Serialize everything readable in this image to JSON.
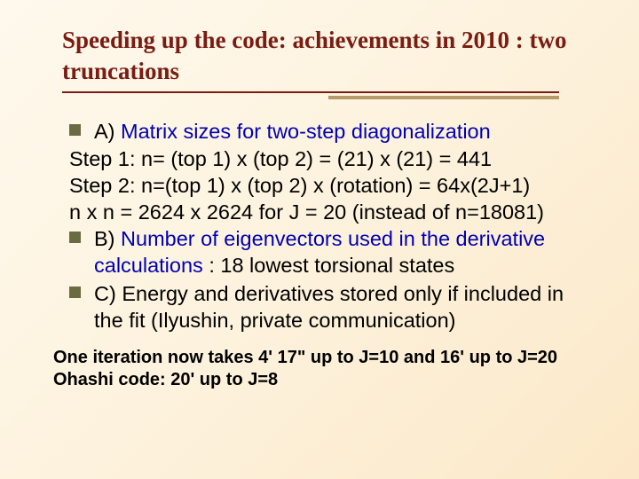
{
  "title": "Speeding up the code: achievements in 2010 : two truncations",
  "bullets": {
    "a_prefix": "A) ",
    "a_blue": "Matrix sizes for two-step diagonalization",
    "step1": "Step 1:  n= (top 1) x (top 2) = (21) x (21) = 441",
    "step2": "Step 2: n=(top 1) x (top 2) x (rotation) = 64x(2J+1)",
    "nxn": " n x n = 2624 x 2624 for J = 20 (instead of n=18081)",
    "b_prefix": "B) ",
    "b_blue": "Number of eigenvectors used in the derivative calculations",
    "b_tail": " : 18 lowest torsional states",
    "c": "C) Energy and derivatives stored only if included in the fit (Ilyushin, private communication)"
  },
  "footer": {
    "line1": "One iteration now takes 4' 17\" up to J=10 and 16' up to J=20",
    "line2": "Ohashi code: 20' up to J=8"
  }
}
